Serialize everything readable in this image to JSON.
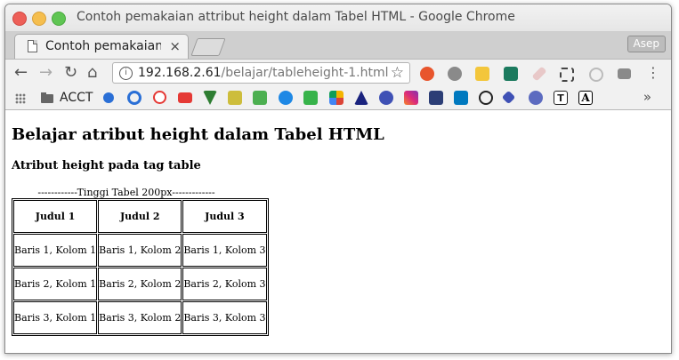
{
  "window": {
    "title": "Contoh pemakaian attribut height dalam Tabel HTML - Google Chrome"
  },
  "tabs": [
    {
      "label": "Contoh pemakaian",
      "close_icon": "×"
    }
  ],
  "profile": {
    "label": "Asep"
  },
  "omnibox": {
    "host": "192.168.2.61",
    "path": "/belajar/tableheight-1.html"
  },
  "bookmarks": {
    "folder_label": "ACCT",
    "more_label": "»"
  },
  "extension_colors": [
    "#e8552c",
    "#7a7a7a",
    "#f3c63b",
    "#1b7a5e",
    "#d4d4d4",
    "#333333",
    "#cccccc",
    "#7a7a7a"
  ],
  "bookmark_colors": [
    "#2a6fd6",
    "#2a6fd6",
    "#e8e8e8",
    "#e53935",
    "#2e7d32",
    "#cdbd3c",
    "#4caf50",
    "#1e88e5",
    "#37b34a",
    "#f4b400",
    "#1a237e",
    "#3f51b5",
    "#e1306c",
    "#2c3e76",
    "#0079bf",
    "#222222",
    "#3f51b5",
    "#5c6bc0",
    "#222222",
    "#000000"
  ],
  "page": {
    "heading": "Belajar atribut height dalam Tabel HTML",
    "subheading": "Atribut height pada tag table",
    "caption": "------------Tinggi Tabel 200px-------------",
    "table": {
      "headers": [
        "Judul 1",
        "Judul 2",
        "Judul 3"
      ],
      "rows": [
        [
          "Baris 1, Kolom 1",
          "Baris 1, Kolom 2",
          "Baris 1, Kolom 3"
        ],
        [
          "Baris 2, Kolom 1",
          "Baris 2, Kolom 2",
          "Baris 2, Kolom 3"
        ],
        [
          "Baris 3, Kolom 1",
          "Baris 3, Kolom 2",
          "Baris 3, Kolom 3"
        ]
      ]
    }
  }
}
